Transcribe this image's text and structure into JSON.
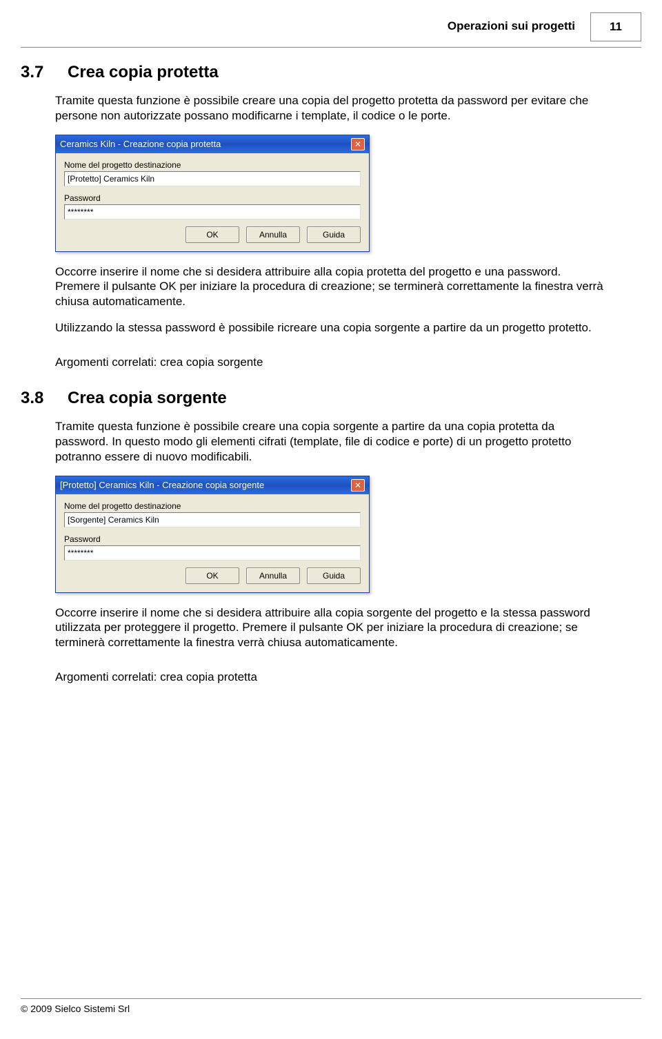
{
  "header": {
    "title": "Operazioni sui progetti",
    "page_number": "11"
  },
  "section37": {
    "number": "3.7",
    "title": "Crea copia protetta",
    "intro": "Tramite questa funzione è possibile creare una copia del progetto protetta da password per evitare che persone non autorizzate possano modificarne i template, il codice o le porte.",
    "para_after1": "Occorre inserire il nome che si desidera attribuire alla copia protetta del progetto e una password. Premere il pulsante OK per iniziare la procedura di creazione; se terminerà correttamente la finestra verrà chiusa automaticamente.",
    "para_after2": "Utilizzando la stessa password è possibile ricreare una copia sorgente a partire da un progetto protetto.",
    "related": "Argomenti correlati: crea copia sorgente"
  },
  "dialog37": {
    "title": "Ceramics Kiln - Creazione copia protetta",
    "label_dest": "Nome del progetto destinazione",
    "value_dest": "[Protetto] Ceramics Kiln",
    "label_pwd": "Password",
    "value_pwd": "********",
    "btn_ok": "OK",
    "btn_cancel": "Annulla",
    "btn_help": "Guida"
  },
  "section38": {
    "number": "3.8",
    "title": "Crea copia sorgente",
    "intro": "Tramite questa funzione è possibile creare una copia sorgente a partire da una copia protetta da password. In questo modo gli elementi cifrati (template, file di codice e porte) di un progetto protetto potranno essere di nuovo modificabili.",
    "para_after1": "Occorre inserire il nome che si desidera attribuire alla copia sorgente del progetto e la stessa password utilizzata per proteggere il progetto. Premere il pulsante OK per iniziare la procedura di creazione; se terminerà correttamente la finestra verrà chiusa automaticamente.",
    "related": "Argomenti correlati: crea copia protetta"
  },
  "dialog38": {
    "title": "[Protetto] Ceramics Kiln - Creazione copia sorgente",
    "label_dest": "Nome del progetto destinazione",
    "value_dest": "[Sorgente] Ceramics Kiln",
    "label_pwd": "Password",
    "value_pwd": "********",
    "btn_ok": "OK",
    "btn_cancel": "Annulla",
    "btn_help": "Guida"
  },
  "footer": {
    "copyright": "© 2009 Sielco Sistemi Srl"
  }
}
